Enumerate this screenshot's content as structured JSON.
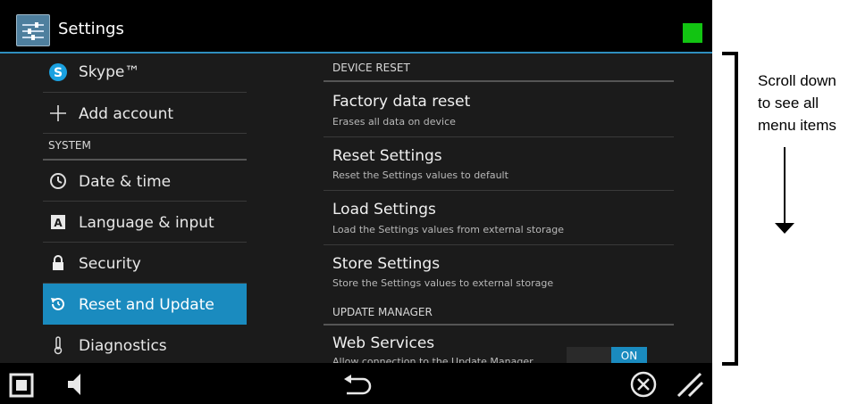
{
  "titlebar": {
    "title": "Settings",
    "status_color": "#12c412"
  },
  "left_menu": {
    "items": [
      {
        "label": "Skype™",
        "icon": "skype-icon"
      },
      {
        "label": "Add account",
        "icon": "plus-icon"
      },
      {
        "header": "SYSTEM"
      },
      {
        "label": "Date & time",
        "icon": "clock-icon"
      },
      {
        "label": "Language & input",
        "icon": "keyboard-a-icon"
      },
      {
        "label": "Security",
        "icon": "lock-icon"
      },
      {
        "label": "Reset and Update",
        "icon": "restore-icon",
        "active": true
      },
      {
        "label": "Diagnostics",
        "icon": "thermometer-icon"
      }
    ]
  },
  "right_panel": {
    "device_reset_header": "DEVICE RESET",
    "items": [
      {
        "title": "Factory data reset",
        "subtitle": "Erases all data on device"
      },
      {
        "title": "Reset Settings",
        "subtitle": "Reset the Settings values to default"
      },
      {
        "title": "Load Settings",
        "subtitle": "Load the Settings values from external storage"
      },
      {
        "title": "Store Settings",
        "subtitle": "Store the Settings values to external storage"
      }
    ],
    "update_manager_header": "UPDATE MANAGER",
    "web_services": {
      "title": "Web Services",
      "subtitle": "Allow connection to the Update Manager",
      "toggle": "ON"
    }
  },
  "navbar": {
    "icons": [
      "stop-square-icon",
      "speaker-icon",
      "back-icon",
      "close-circle-icon",
      "resize-handle-icon"
    ]
  },
  "annotation": {
    "text_line1": "Scroll down",
    "text_line2": "to see all",
    "text_line3": "menu items"
  },
  "colors": {
    "accent": "#1a8bbf",
    "background": "#1b1b1b"
  }
}
